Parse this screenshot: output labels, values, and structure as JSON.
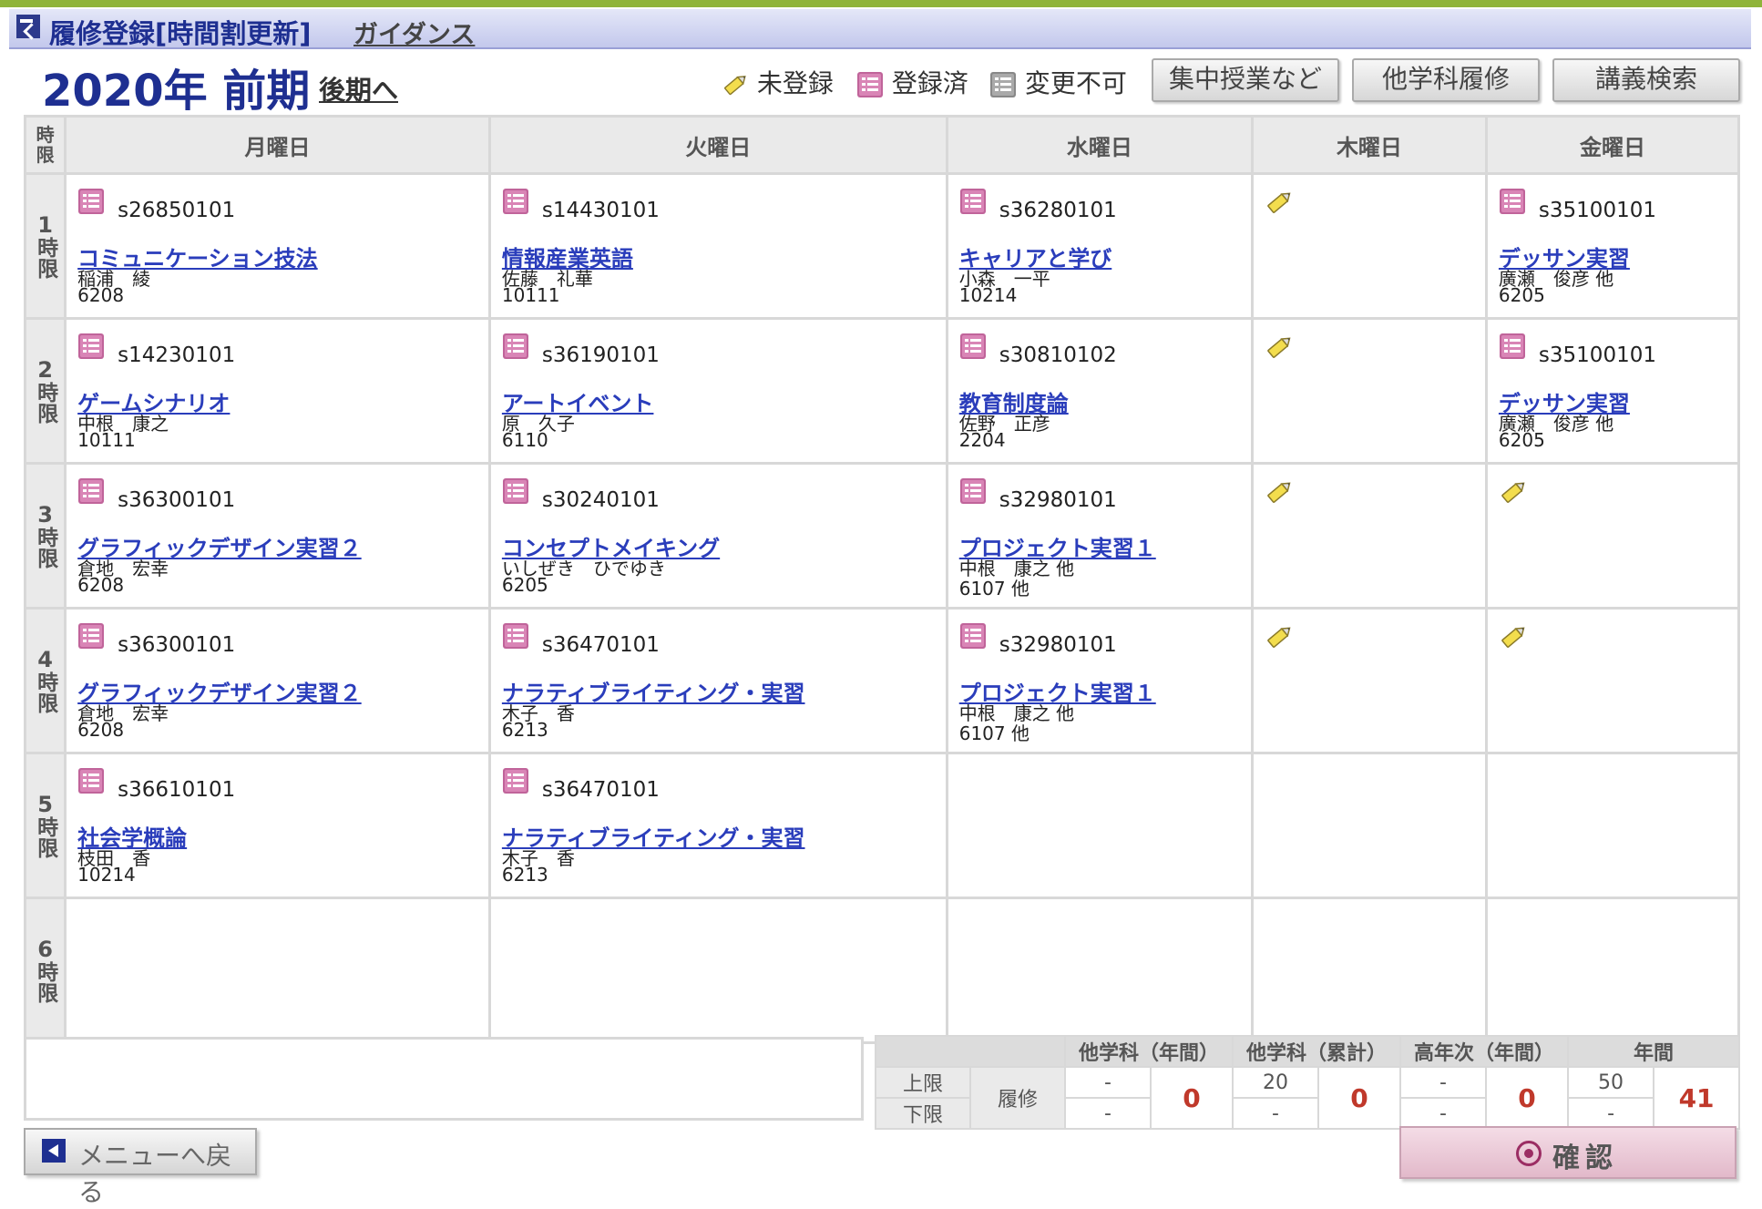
{
  "header": {
    "title": "履修登録[時間割更新]",
    "guidance_link": "ガイダンス",
    "term": "2020年 前期",
    "other_term_link": "後期へ"
  },
  "legend": {
    "unregistered": "未登録",
    "registered": "登録済",
    "locked": "変更不可"
  },
  "buttons": {
    "intensive": "集中授業など",
    "other_dept": "他学科履修",
    "search": "講義検索",
    "back": "メニューへ戻る",
    "confirm": "確認"
  },
  "grid": {
    "corner": "時限",
    "days": [
      "月曜日",
      "火曜日",
      "水曜日",
      "木曜日",
      "金曜日"
    ],
    "periods": [
      {
        "label": "1時限",
        "num": "1",
        "unit": "時限",
        "cells": [
          {
            "state": "registered",
            "code": "s26850101",
            "name": "コミュニケーション技法",
            "teacher": "稲浦　綾",
            "room": "6208"
          },
          {
            "state": "registered",
            "code": "s14430101",
            "name": "情報産業英語",
            "teacher": "佐藤　礼華",
            "room": "10111"
          },
          {
            "state": "registered",
            "code": "s36280101",
            "name": "キャリアと学び",
            "teacher": "小森　一平",
            "room": "10214"
          },
          {
            "state": "unregistered"
          },
          {
            "state": "registered",
            "code": "s35100101",
            "name": "デッサン実習",
            "teacher": "廣瀬　俊彦 他",
            "room": "6205"
          }
        ]
      },
      {
        "label": "2時限",
        "num": "2",
        "unit": "時限",
        "cells": [
          {
            "state": "registered",
            "code": "s14230101",
            "name": "ゲームシナリオ",
            "teacher": "中根　康之",
            "room": "10111"
          },
          {
            "state": "registered",
            "code": "s36190101",
            "name": "アートイベント",
            "teacher": "原　久子",
            "room": "6110"
          },
          {
            "state": "registered",
            "code": "s30810102",
            "name": "教育制度論",
            "teacher": "佐野　正彦",
            "room": "2204"
          },
          {
            "state": "unregistered"
          },
          {
            "state": "registered",
            "code": "s35100101",
            "name": "デッサン実習",
            "teacher": "廣瀬　俊彦 他",
            "room": "6205"
          }
        ]
      },
      {
        "label": "3時限",
        "num": "3",
        "unit": "時限",
        "cells": [
          {
            "state": "registered",
            "code": "s36300101",
            "name": "グラフィックデザイン実習２",
            "teacher": "倉地　宏幸",
            "room": "6208"
          },
          {
            "state": "registered",
            "code": "s30240101",
            "name": "コンセプトメイキング",
            "teacher": "いしぜき　ひでゆき",
            "room": "6205"
          },
          {
            "state": "registered",
            "code": "s32980101",
            "name": "プロジェクト実習１",
            "teacher": "中根　康之 他",
            "room": "6107 他"
          },
          {
            "state": "unregistered"
          },
          {
            "state": "unregistered"
          }
        ]
      },
      {
        "label": "4時限",
        "num": "4",
        "unit": "時限",
        "cells": [
          {
            "state": "registered",
            "code": "s36300101",
            "name": "グラフィックデザイン実習２",
            "teacher": "倉地　宏幸",
            "room": "6208"
          },
          {
            "state": "registered",
            "code": "s36470101",
            "name": "ナラティブライティング・実習",
            "teacher": "木子　香",
            "room": "6213"
          },
          {
            "state": "registered",
            "code": "s32980101",
            "name": "プロジェクト実習１",
            "teacher": "中根　康之 他",
            "room": "6107 他"
          },
          {
            "state": "unregistered"
          },
          {
            "state": "unregistered"
          }
        ]
      },
      {
        "label": "5時限",
        "num": "5",
        "unit": "時限",
        "cells": [
          {
            "state": "registered",
            "code": "s36610101",
            "name": "社会学概論",
            "teacher": "枝田　香",
            "room": "10214"
          },
          {
            "state": "registered",
            "code": "s36470101",
            "name": "ナラティブライティング・実習",
            "teacher": "木子　香",
            "room": "6213"
          },
          {
            "state": "empty"
          },
          {
            "state": "empty"
          },
          {
            "state": "empty"
          }
        ]
      },
      {
        "label": "6時限",
        "num": "6",
        "unit": "時限",
        "cells": [
          {
            "state": "empty"
          },
          {
            "state": "empty"
          },
          {
            "state": "empty"
          },
          {
            "state": "empty"
          },
          {
            "state": "empty"
          }
        ]
      }
    ]
  },
  "limits": {
    "headers": [
      "他学科（年間）",
      "他学科（累計）",
      "高年次（年間）",
      "年間"
    ],
    "upper_label": "上限",
    "lower_label": "下限",
    "row_label": "履修",
    "groups": [
      {
        "upper": "-",
        "lower": "-",
        "value": "0"
      },
      {
        "upper": "20",
        "lower": "-",
        "value": "0"
      },
      {
        "upper": "-",
        "lower": "-",
        "value": "0"
      },
      {
        "upper": "50",
        "lower": "-",
        "value": "41"
      }
    ]
  },
  "colors": {
    "accent": "#1e2f91",
    "link": "#2a3dbb",
    "registered_icon": "#b24d8a",
    "pencil": "#f1d94a",
    "value": "#c0392b"
  }
}
